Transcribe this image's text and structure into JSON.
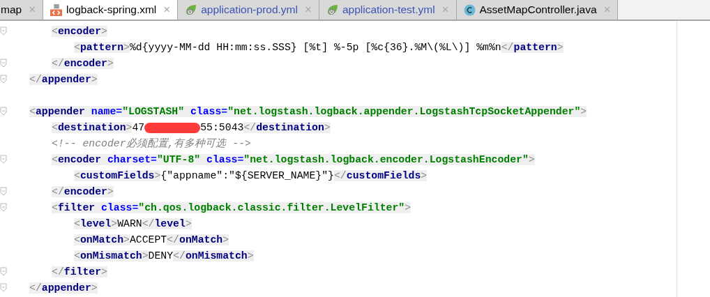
{
  "tabs": [
    {
      "label": "map",
      "kind": "none",
      "modified": false,
      "selected": false,
      "close": "×"
    },
    {
      "label": "logback-spring.xml",
      "kind": "xml",
      "modified": false,
      "selected": true,
      "close": "×"
    },
    {
      "label": "application-prod.yml",
      "kind": "spring",
      "modified": true,
      "selected": false,
      "close": "×"
    },
    {
      "label": "application-test.yml",
      "kind": "spring",
      "modified": true,
      "selected": false,
      "close": "×"
    },
    {
      "label": "AssetMapController.java",
      "kind": "class",
      "modified": false,
      "selected": false,
      "close": "×"
    }
  ],
  "code": [
    {
      "kind": "code",
      "children": [
        {
          "kind": "code",
          "fold": true,
          "tokens": [
            {
              "kind": "punct",
              "text": "<"
            },
            {
              "kind": "tag",
              "text": "encoder"
            },
            {
              "kind": "punct",
              "text": ">"
            }
          ],
          "children": [
            {
              "kind": "code",
              "tokens": [
                {
                  "kind": "punct",
                  "text": "<"
                },
                {
                  "kind": "tag",
                  "text": "pattern"
                },
                {
                  "kind": "punct",
                  "text": ">"
                },
                {
                  "kind": "text",
                  "text": "%d{yyyy-MM-dd HH:mm:ss.SSS} [%t] %-5p [%c{36}.%M\\(%L\\)] %m%n"
                },
                {
                  "kind": "punct",
                  "text": "</"
                },
                {
                  "kind": "tag",
                  "text": "pattern"
                },
                {
                  "kind": "punct",
                  "text": ">"
                }
              ]
            }
          ]
        },
        {
          "kind": "code",
          "fold": true,
          "tokens": [
            {
              "kind": "punct",
              "text": "</"
            },
            {
              "kind": "tag",
              "text": "encoder"
            },
            {
              "kind": "punct",
              "text": ">"
            }
          ]
        }
      ]
    },
    {
      "kind": "code",
      "fold": true,
      "tokens": [
        {
          "kind": "punct",
          "text": "</"
        },
        {
          "kind": "tag",
          "text": "appender"
        },
        {
          "kind": "punct",
          "text": ">"
        }
      ]
    },
    {
      "kind": "blank"
    },
    {
      "kind": "code",
      "fold": true,
      "tokens": [
        {
          "kind": "punct",
          "text": "<"
        },
        {
          "kind": "tag",
          "text": "appender"
        },
        {
          "kind": "attr",
          "text": " name="
        },
        {
          "kind": "value",
          "text": "\"LOGSTASH\""
        },
        {
          "kind": "attr",
          "text": " class="
        },
        {
          "kind": "value",
          "text": "\"net.logstash.logback.appender.LogstashTcpSocketAppender\""
        },
        {
          "kind": "punct",
          "text": ">"
        }
      ],
      "children": [
        {
          "kind": "code",
          "tokens": [
            {
              "kind": "punct",
              "text": "<"
            },
            {
              "kind": "tag",
              "text": "destination"
            },
            {
              "kind": "punct",
              "text": ">"
            },
            {
              "kind": "text",
              "text": "47"
            },
            {
              "kind": "redacted"
            },
            {
              "kind": "text",
              "text": "55:5043"
            },
            {
              "kind": "punct",
              "text": "</"
            },
            {
              "kind": "tag",
              "text": "destination"
            },
            {
              "kind": "punct",
              "text": ">"
            }
          ]
        },
        {
          "kind": "code",
          "tokens": [
            {
              "kind": "comment",
              "text": "<!-- encoder必须配置,有多种可选 -->"
            }
          ]
        },
        {
          "kind": "code",
          "fold": true,
          "tokens": [
            {
              "kind": "punct",
              "text": "<"
            },
            {
              "kind": "tag",
              "text": "encoder"
            },
            {
              "kind": "attr",
              "text": " charset="
            },
            {
              "kind": "value",
              "text": "\"UTF-8\""
            },
            {
              "kind": "attr",
              "text": " class="
            },
            {
              "kind": "value",
              "text": "\"net.logstash.logback.encoder.LogstashEncoder\""
            },
            {
              "kind": "punct",
              "text": ">"
            }
          ],
          "children": [
            {
              "kind": "code",
              "tokens": [
                {
                  "kind": "punct",
                  "text": "<"
                },
                {
                  "kind": "tag",
                  "text": "customFields"
                },
                {
                  "kind": "punct",
                  "text": ">"
                },
                {
                  "kind": "text",
                  "text": "{\"appname\":\"${SERVER_NAME}\"}"
                },
                {
                  "kind": "punct",
                  "text": "</"
                },
                {
                  "kind": "tag",
                  "text": "customFields"
                },
                {
                  "kind": "punct",
                  "text": ">"
                }
              ]
            }
          ]
        },
        {
          "kind": "code",
          "fold": true,
          "tokens": [
            {
              "kind": "punct",
              "text": "</"
            },
            {
              "kind": "tag",
              "text": "encoder"
            },
            {
              "kind": "punct",
              "text": ">"
            }
          ]
        },
        {
          "kind": "code",
          "fold": true,
          "tokens": [
            {
              "kind": "punct",
              "text": "<"
            },
            {
              "kind": "tag",
              "text": "filter"
            },
            {
              "kind": "attr",
              "text": " class="
            },
            {
              "kind": "value",
              "text": "\"ch.qos.logback.classic.filter.LevelFilter\""
            },
            {
              "kind": "punct",
              "text": ">"
            }
          ],
          "children": [
            {
              "kind": "code",
              "tokens": [
                {
                  "kind": "punct",
                  "text": "<"
                },
                {
                  "kind": "tag",
                  "text": "level"
                },
                {
                  "kind": "punct",
                  "text": ">"
                },
                {
                  "kind": "text",
                  "text": "WARN"
                },
                {
                  "kind": "punct",
                  "text": "</"
                },
                {
                  "kind": "tag",
                  "text": "level"
                },
                {
                  "kind": "punct",
                  "text": ">"
                }
              ]
            },
            {
              "kind": "code",
              "tokens": [
                {
                  "kind": "punct",
                  "text": "<"
                },
                {
                  "kind": "tag",
                  "text": "onMatch"
                },
                {
                  "kind": "punct",
                  "text": ">"
                },
                {
                  "kind": "text",
                  "text": "ACCEPT"
                },
                {
                  "kind": "punct",
                  "text": "</"
                },
                {
                  "kind": "tag",
                  "text": "onMatch"
                },
                {
                  "kind": "punct",
                  "text": ">"
                }
              ]
            },
            {
              "kind": "code",
              "tokens": [
                {
                  "kind": "punct",
                  "text": "<"
                },
                {
                  "kind": "tag",
                  "text": "onMismatch"
                },
                {
                  "kind": "punct",
                  "text": ">"
                },
                {
                  "kind": "text",
                  "text": "DENY"
                },
                {
                  "kind": "punct",
                  "text": "</"
                },
                {
                  "kind": "tag",
                  "text": "onMismatch"
                },
                {
                  "kind": "punct",
                  "text": ">"
                }
              ]
            }
          ]
        },
        {
          "kind": "code",
          "fold": true,
          "tokens": [
            {
              "kind": "punct",
              "text": "</"
            },
            {
              "kind": "tag",
              "text": "filter"
            },
            {
              "kind": "punct",
              "text": ">"
            }
          ]
        }
      ]
    },
    {
      "kind": "code",
      "fold": true,
      "tokens": [
        {
          "kind": "punct",
          "text": "</"
        },
        {
          "kind": "tag",
          "text": "appender"
        },
        {
          "kind": "punct",
          "text": ">"
        }
      ]
    }
  ]
}
